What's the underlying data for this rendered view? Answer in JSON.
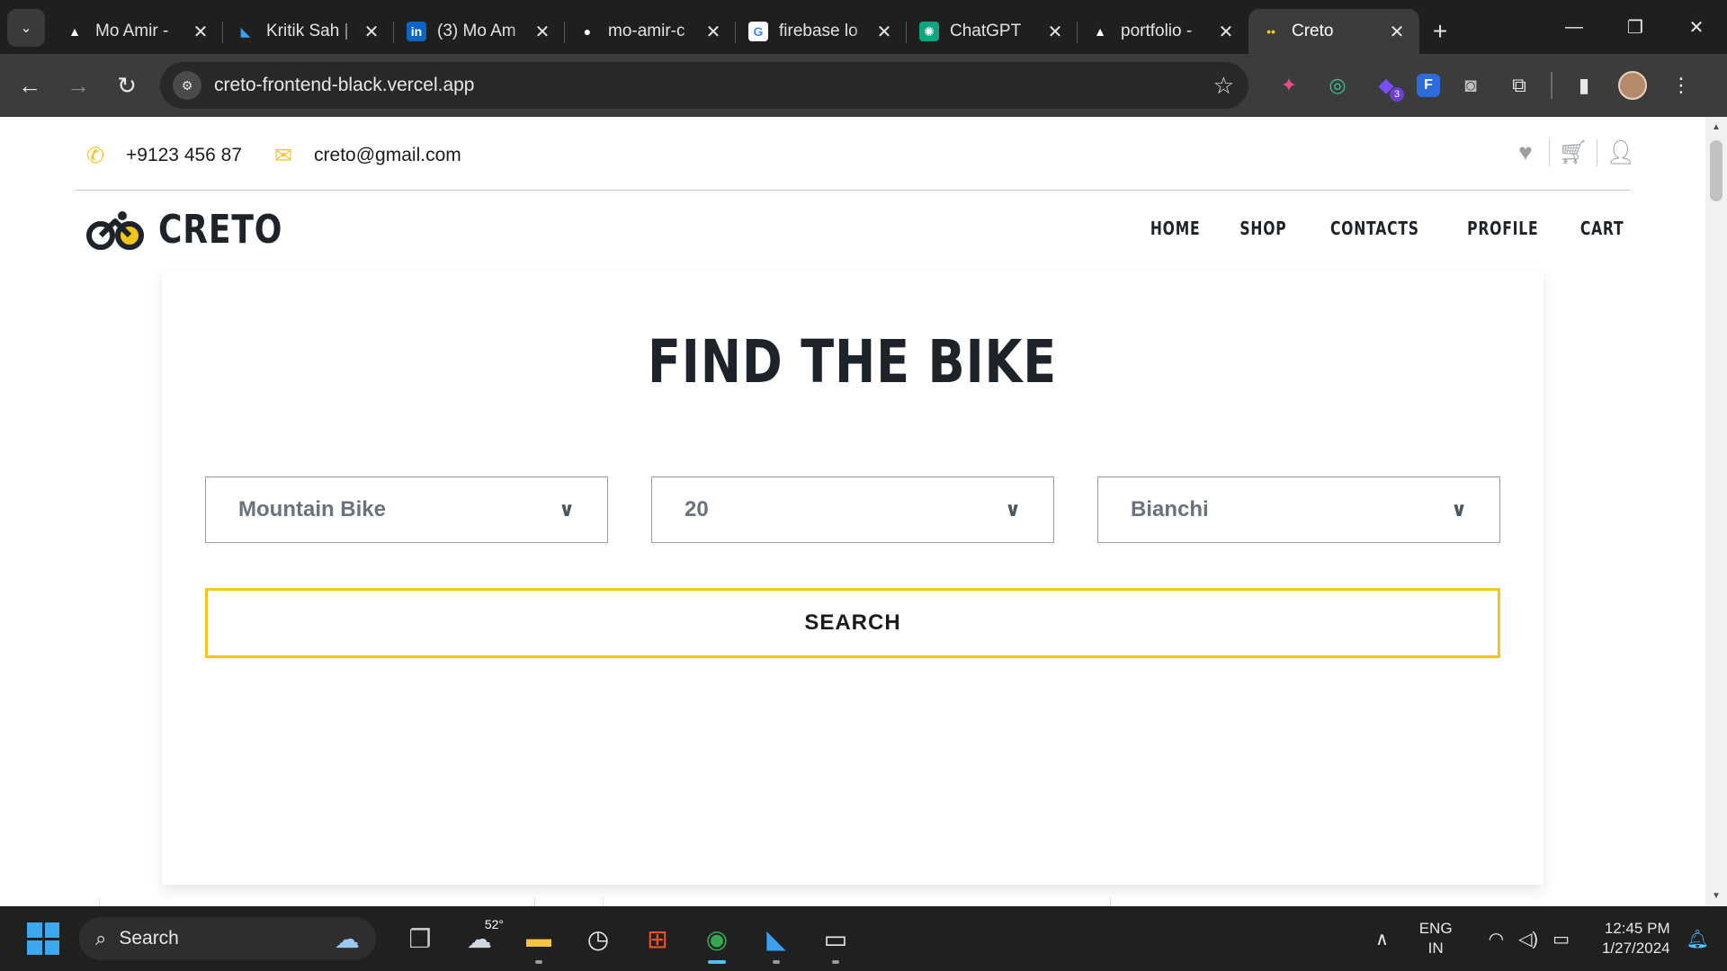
{
  "browser": {
    "tabs": [
      {
        "title": "Mo Amir -",
        "favicon": "▲",
        "favicon_color": "#ffffff",
        "favicon_bg": "transparent"
      },
      {
        "title": "Kritik Sah |",
        "favicon": "◣",
        "favicon_color": "#3aa0f0",
        "favicon_bg": "transparent"
      },
      {
        "title": "(3) Mo Am",
        "favicon": "in",
        "favicon_color": "#ffffff",
        "favicon_bg": "#0a66c2"
      },
      {
        "title": "mo-amir-c",
        "favicon": "●",
        "favicon_color": "#ffffff",
        "favicon_bg": "transparent"
      },
      {
        "title": "firebase lo",
        "favicon": "G",
        "favicon_color": "#4285f4",
        "favicon_bg": "#ffffff"
      },
      {
        "title": "ChatGPT",
        "favicon": "✺",
        "favicon_color": "#ffffff",
        "favicon_bg": "#10a37f"
      },
      {
        "title": "portfolio -",
        "favicon": "▲",
        "favicon_color": "#ffffff",
        "favicon_bg": "transparent"
      },
      {
        "title": "Creto",
        "favicon": "••",
        "favicon_color": "#f5c518",
        "favicon_bg": "transparent",
        "active": true
      }
    ],
    "url": "creto-frontend-black.vercel.app",
    "extension_badge": "3"
  },
  "site": {
    "phone": "+9123 456 87",
    "email": "creto@gmail.com",
    "brand": "CRETO",
    "nav": [
      "HOME",
      "SHOP",
      "CONTACTS",
      "PROFILE",
      "CART"
    ],
    "accent_color": "#f5c518",
    "dark_color": "#1e2329"
  },
  "finder": {
    "title": "FIND THE BIKE",
    "selects": [
      {
        "name": "bike-type",
        "value": "Mountain Bike"
      },
      {
        "name": "wheel-size",
        "value": "20"
      },
      {
        "name": "brand",
        "value": "Bianchi"
      }
    ],
    "search_label": "SEARCH"
  },
  "taskbar": {
    "search_label": "Search",
    "weather_temp": "52°",
    "lang_line1": "ENG",
    "lang_line2": "IN",
    "time": "12:45 PM",
    "date": "1/27/2024"
  }
}
